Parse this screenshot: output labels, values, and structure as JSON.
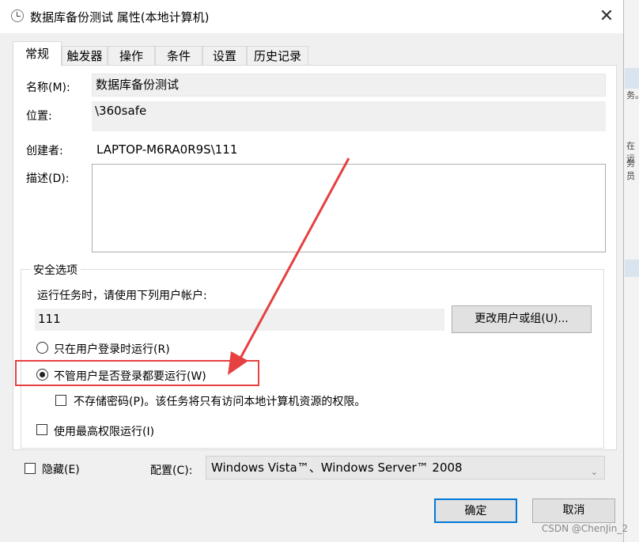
{
  "window": {
    "title": "数据库备份测试 属性(本地计算机)",
    "close_label": "✕"
  },
  "tabs": [
    {
      "label": "常规",
      "active": true
    },
    {
      "label": "触发器",
      "active": false
    },
    {
      "label": "操作",
      "active": false
    },
    {
      "label": "条件",
      "active": false
    },
    {
      "label": "设置",
      "active": false
    },
    {
      "label": "历史记录",
      "active": false
    }
  ],
  "general": {
    "name_label": "名称(M):",
    "name_value": "数据库备份测试",
    "location_label": "位置:",
    "location_value": "\\360safe",
    "author_label": "创建者:",
    "author_value": "LAPTOP-M6RA0R9S\\111",
    "description_label": "描述(D):",
    "description_value": ""
  },
  "security": {
    "group_title": "安全选项",
    "run_as_label": "运行任务时，请使用下列用户帐户:",
    "user_value": "111",
    "change_user_button": "更改用户或组(U)...",
    "radio_logged_on": "只在用户登录时运行(R)",
    "radio_logged_on_checked": false,
    "radio_whether_logged_on": "不管用户是否登录都要运行(W)",
    "radio_whether_logged_on_checked": true,
    "do_not_store_password": "不存储密码(P)。该任务将只有访问本地计算机资源的权限。",
    "do_not_store_password_checked": false,
    "highest_privileges": "使用最高权限运行(I)",
    "highest_privileges_checked": false
  },
  "bottom": {
    "hidden_label": "隐藏(E)",
    "hidden_checked": false,
    "configure_label": "配置(C):",
    "configure_value": "Windows Vista™、Windows Server™ 2008"
  },
  "buttons": {
    "ok": "确定",
    "cancel": "取消"
  },
  "watermark": "CSDN @ChenJin_2",
  "background_fragments": [
    "务。",
    "在运",
    "务员"
  ],
  "colors": {
    "annotation_red": "#e64040",
    "ok_border": "#0078d7"
  }
}
